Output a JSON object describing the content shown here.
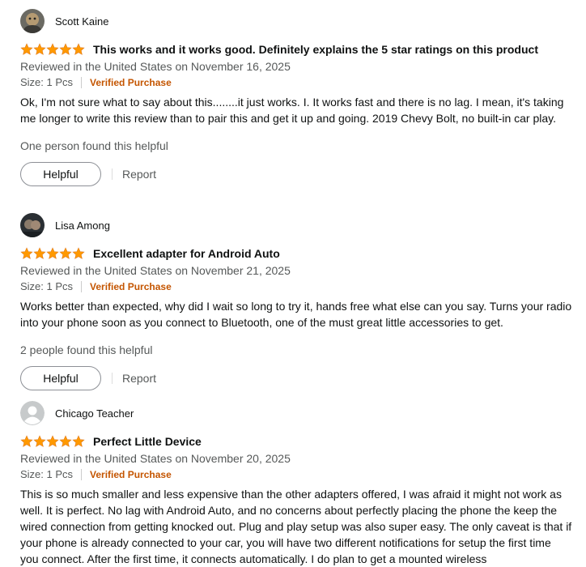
{
  "reviews": [
    {
      "author": "Scott Kaine",
      "avatar": "photo-avatar",
      "rating": 5,
      "title": "This works and it works good. Definitely explains the 5 star ratings on this product",
      "reviewed": "Reviewed in the United States on November 16, 2025",
      "size": "Size: 1 Pcs",
      "verified": "Verified Purchase",
      "body": "Ok, I'm not sure what to say about this........it just works. I. It works fast and there is no lag. I mean, it's taking me longer to write this review than to pair this and get it up and going. 2019 Chevy Bolt, no built-in car play.",
      "helpful_count": "One person found this helpful",
      "helpful_label": "Helpful",
      "report_label": "Report"
    },
    {
      "author": "Lisa Among",
      "avatar": "photo-avatar",
      "rating": 5,
      "title": "Excellent adapter for Android Auto",
      "reviewed": "Reviewed in the United States on November 21, 2025",
      "size": "Size: 1 Pcs",
      "verified": "Verified Purchase",
      "body": "Works better than expected, why did I wait so long to try it, hands free what else can you say. Turns your radio into your phone soon as you connect to Bluetooth, one of the must great little accessories to get.",
      "helpful_count": "2 people found this helpful",
      "helpful_label": "Helpful",
      "report_label": "Report"
    },
    {
      "author": "Chicago Teacher",
      "avatar": "default-avatar",
      "rating": 5,
      "title": "Perfect Little Device",
      "reviewed": "Reviewed in the United States on November 20, 2025",
      "size": "Size: 1 Pcs",
      "verified": "Verified Purchase",
      "body": "This is so much smaller and less expensive than the other adapters offered, I was afraid it might not work as well. It is perfect. No lag with Android Auto, and no concerns about perfectly placing the phone the keep the wired connection from getting knocked out. Plug and play setup was also super easy. The only caveat is that if your phone is already connected to your car, you will have two different notifications for setup the first time you connect. After the first time, it connects automatically. I do plan to get a mounted wireless"
    }
  ],
  "colors": {
    "star": "#ff9900",
    "verified": "#c45500",
    "secondary_text": "#565959"
  }
}
